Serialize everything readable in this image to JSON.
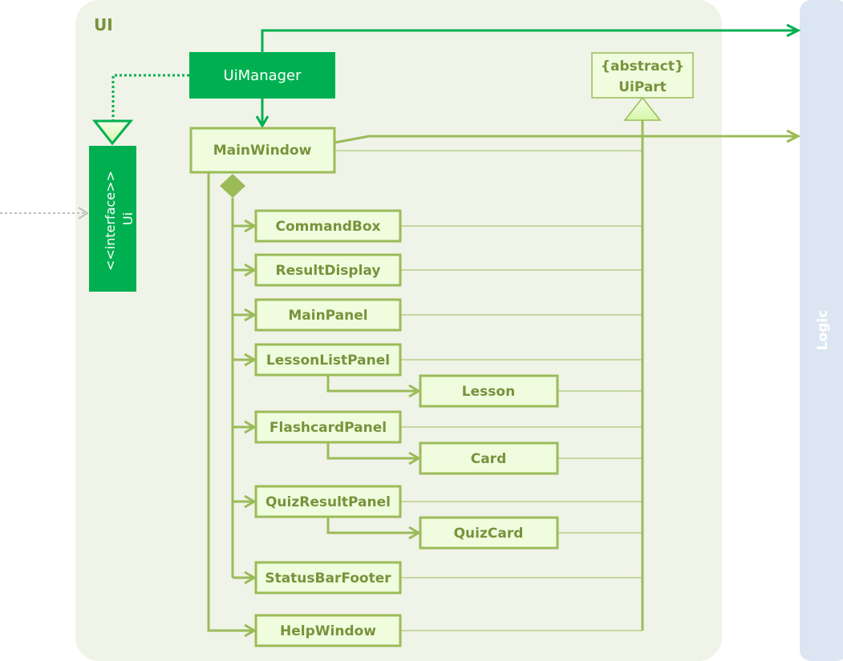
{
  "colors": {
    "component": "#00B050",
    "class_fill": "#EFFCDD",
    "class_border": "#9BBB59",
    "class_text": "#77933C",
    "package_bg": "#F0F3E8",
    "logic_bg": "#DCE6F2"
  },
  "package": {
    "title": "UI"
  },
  "logic": {
    "title": "Logic"
  },
  "ui_manager": {
    "label": "UiManager"
  },
  "ui_interface": {
    "stereotype": "<<interface>>",
    "label": "Ui"
  },
  "ui_part": {
    "stereotype": "{abstract}",
    "label": "UiPart"
  },
  "main_window": {
    "label": "MainWindow"
  },
  "children": [
    {
      "label": "CommandBox"
    },
    {
      "label": "ResultDisplay"
    },
    {
      "label": "MainPanel"
    },
    {
      "label": "LessonListPanel",
      "sub": "Lesson"
    },
    {
      "label": "FlashcardPanel",
      "sub": "Card"
    },
    {
      "label": "QuizResultPanel",
      "sub": "QuizCard"
    },
    {
      "label": "StatusBarFooter"
    }
  ],
  "help_window": {
    "label": "HelpWindow"
  }
}
